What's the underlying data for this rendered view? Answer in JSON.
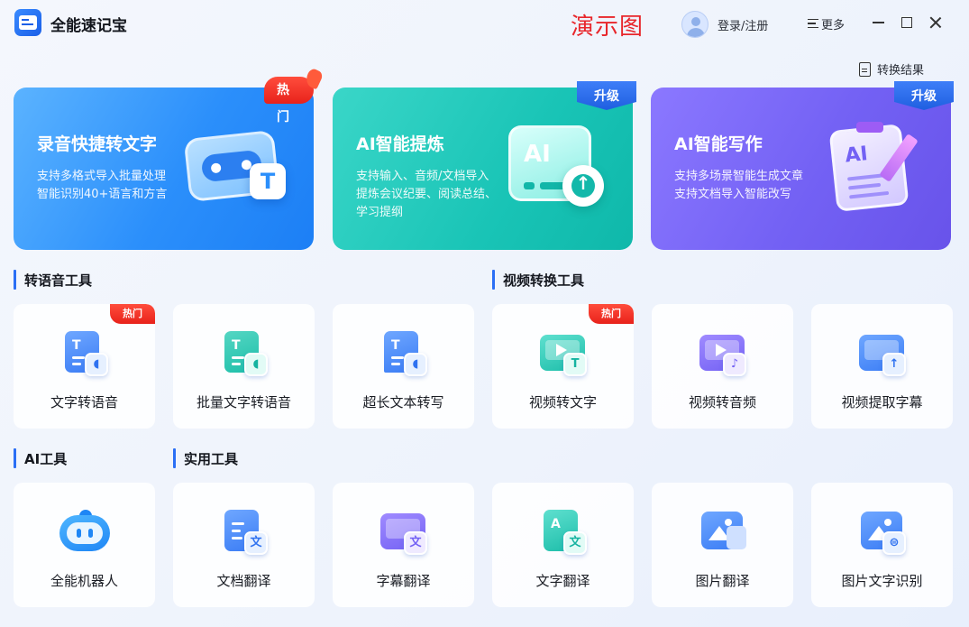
{
  "app": {
    "title": "全能速记宝",
    "watermark": "演示图"
  },
  "titlebar": {
    "login": "登录/注册",
    "more": "更多"
  },
  "toolbar": {
    "results": "转换结果"
  },
  "heroes": [
    {
      "title": "录音快捷转文字",
      "badge": "热门",
      "lines": [
        "支持多格式导入批量处理",
        "智能识别40+语言和方言"
      ],
      "illus_letter": "T"
    },
    {
      "title": "AI智能提炼",
      "badge": "升级",
      "lines": [
        "支持输入、音频/文档导入",
        "提炼会议纪要、阅读总结、",
        "学习提纲"
      ],
      "illus_letter": "AI"
    },
    {
      "title": "AI智能写作",
      "badge": "升级",
      "lines": [
        "支持多场景智能生成文章",
        "支持文档导入智能改写"
      ],
      "illus_letter": "AI"
    }
  ],
  "sections": {
    "tts": "转语音工具",
    "video": "视频转换工具",
    "ai": "AI工具",
    "util": "实用工具"
  },
  "tools_row1": [
    {
      "label": "文字转语音",
      "badge": "热门",
      "icon": "text-to-speech-icon"
    },
    {
      "label": "批量文字转语音",
      "badge": "",
      "icon": "batch-text-to-speech-icon"
    },
    {
      "label": "超长文本转写",
      "badge": "",
      "icon": "long-text-icon"
    },
    {
      "label": "视频转文字",
      "badge": "热门",
      "icon": "video-to-text-icon"
    },
    {
      "label": "视频转音频",
      "badge": "",
      "icon": "video-to-audio-icon"
    },
    {
      "label": "视频提取字幕",
      "badge": "",
      "icon": "extract-subtitle-icon"
    }
  ],
  "tools_row2": [
    {
      "label": "全能机器人",
      "icon": "robot-icon"
    },
    {
      "label": "文档翻译",
      "icon": "doc-translate-icon",
      "sub": "文"
    },
    {
      "label": "字幕翻译",
      "icon": "subtitle-translate-icon",
      "sub": "文"
    },
    {
      "label": "文字翻译",
      "icon": "text-translate-icon",
      "sub": "文"
    },
    {
      "label": "图片翻译",
      "icon": "image-translate-icon"
    },
    {
      "label": "图片文字识别",
      "icon": "image-ocr-icon"
    }
  ],
  "colors": {
    "accent": "#2b6ff5",
    "hot": "#e8221b",
    "watermark": "#e8262b"
  }
}
